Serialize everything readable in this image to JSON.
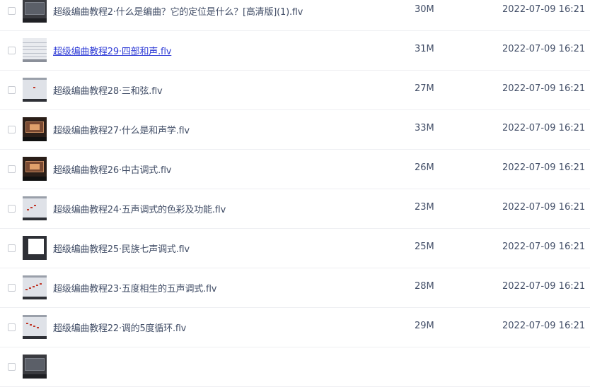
{
  "files": [
    {
      "name": "超级编曲教程2·什么是编曲？它的定位是什么？[高清版](1).flv",
      "size": "30M",
      "date": "2022-07-09 16:21",
      "thumb": "studio",
      "hover": false
    },
    {
      "name": "超级编曲教程29·四部和声.flv",
      "size": "31M",
      "date": "2022-07-09 16:21",
      "thumb": "grid",
      "hover": true
    },
    {
      "name": "超级编曲教程28·三和弦.flv",
      "size": "27M",
      "date": "2022-07-09 16:21",
      "thumb": "score1",
      "hover": false
    },
    {
      "name": "超级编曲教程27·什么是和声学.flv",
      "size": "33M",
      "date": "2022-07-09 16:21",
      "thumb": "room",
      "hover": false
    },
    {
      "name": "超级编曲教程26·中古调式.flv",
      "size": "26M",
      "date": "2022-07-09 16:21",
      "thumb": "room",
      "hover": false
    },
    {
      "name": "超级编曲教程24·五声调式的色彩及功能.flv",
      "size": "23M",
      "date": "2022-07-09 16:21",
      "thumb": "score2",
      "hover": false
    },
    {
      "name": "超级编曲教程25·民族七声调式.flv",
      "size": "25M",
      "date": "2022-07-09 16:21",
      "thumb": "white",
      "hover": false
    },
    {
      "name": "超级编曲教程23·五度相生的五声调式.flv",
      "size": "28M",
      "date": "2022-07-09 16:21",
      "thumb": "score3",
      "hover": false
    },
    {
      "name": "超级编曲教程22·调的5度循环.flv",
      "size": "29M",
      "date": "2022-07-09 16:21",
      "thumb": "score4",
      "hover": false
    },
    {
      "name": "",
      "size": "",
      "date": "",
      "thumb": "studio",
      "hover": false
    }
  ]
}
